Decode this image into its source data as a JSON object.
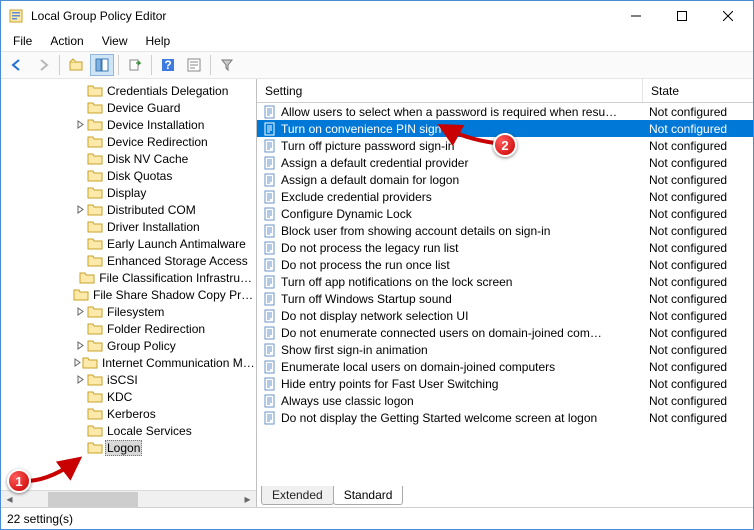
{
  "window": {
    "title": "Local Group Policy Editor"
  },
  "menu": {
    "file": "File",
    "action": "Action",
    "view": "View",
    "help": "Help"
  },
  "columns": {
    "setting": "Setting",
    "state": "State"
  },
  "tabs": {
    "extended": "Extended",
    "standard": "Standard"
  },
  "status": "22 setting(s)",
  "tree": {
    "items": [
      {
        "label": "Credentials Delegation"
      },
      {
        "label": "Device Guard"
      },
      {
        "label": "Device Installation",
        "expandable": true
      },
      {
        "label": "Device Redirection"
      },
      {
        "label": "Disk NV Cache"
      },
      {
        "label": "Disk Quotas"
      },
      {
        "label": "Display"
      },
      {
        "label": "Distributed COM",
        "expandable": true
      },
      {
        "label": "Driver Installation"
      },
      {
        "label": "Early Launch Antimalware"
      },
      {
        "label": "Enhanced Storage Access"
      },
      {
        "label": "File Classification Infrastru…"
      },
      {
        "label": "File Share Shadow Copy Pr…"
      },
      {
        "label": "Filesystem",
        "expandable": true
      },
      {
        "label": "Folder Redirection"
      },
      {
        "label": "Group Policy",
        "expandable": true
      },
      {
        "label": "Internet Communication M…",
        "expandable": true
      },
      {
        "label": "iSCSI",
        "expandable": true
      },
      {
        "label": "KDC"
      },
      {
        "label": "Kerberos"
      },
      {
        "label": "Locale Services"
      },
      {
        "label": "Logon",
        "selected": true
      }
    ]
  },
  "settings": [
    {
      "label": "Allow users to select when a password is required when resu…",
      "state": "Not configured"
    },
    {
      "label": "Turn on convenience PIN sign-in",
      "state": "Not configured",
      "selected": true
    },
    {
      "label": "Turn off picture password sign-in",
      "state": "Not configured"
    },
    {
      "label": "Assign a default credential provider",
      "state": "Not configured"
    },
    {
      "label": "Assign a default domain for logon",
      "state": "Not configured"
    },
    {
      "label": "Exclude credential providers",
      "state": "Not configured"
    },
    {
      "label": "Configure Dynamic Lock",
      "state": "Not configured"
    },
    {
      "label": "Block user from showing account details on sign-in",
      "state": "Not configured"
    },
    {
      "label": "Do not process the legacy run list",
      "state": "Not configured"
    },
    {
      "label": "Do not process the run once list",
      "state": "Not configured"
    },
    {
      "label": "Turn off app notifications on the lock screen",
      "state": "Not configured"
    },
    {
      "label": "Turn off Windows Startup sound",
      "state": "Not configured"
    },
    {
      "label": "Do not display network selection UI",
      "state": "Not configured"
    },
    {
      "label": "Do not enumerate connected users on domain-joined com…",
      "state": "Not configured"
    },
    {
      "label": "Show first sign-in animation",
      "state": "Not configured"
    },
    {
      "label": "Enumerate local users on domain-joined computers",
      "state": "Not configured"
    },
    {
      "label": "Hide entry points for Fast User Switching",
      "state": "Not configured"
    },
    {
      "label": "Always use classic logon",
      "state": "Not configured"
    },
    {
      "label": "Do not display the Getting Started welcome screen at logon",
      "state": "Not configured"
    }
  ],
  "annotations": {
    "step1": "1",
    "step2": "2"
  }
}
